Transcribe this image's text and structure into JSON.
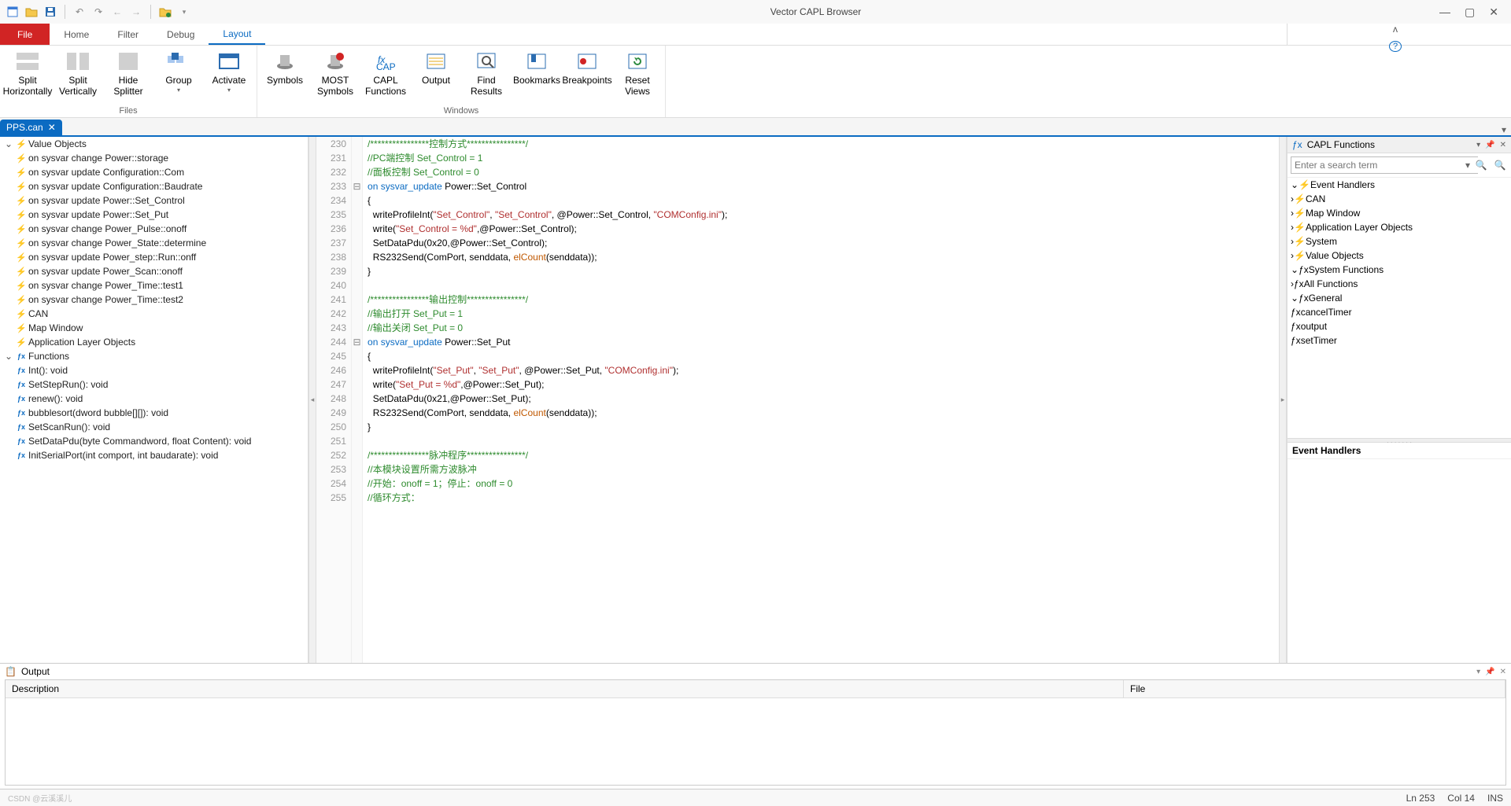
{
  "title": "Vector CAPL Browser",
  "ribbonTabs": {
    "file": "File",
    "home": "Home",
    "filter": "Filter",
    "debug": "Debug",
    "layout": "Layout"
  },
  "ribbon": {
    "files": {
      "label": "Files",
      "splitH": "Split\nHorizontally",
      "splitV": "Split\nVertically",
      "hideSplitter": "Hide\nSplitter",
      "group": "Group",
      "activate": "Activate"
    },
    "windows": {
      "label": "Windows",
      "symbols": "Symbols",
      "most": "MOST\nSymbols",
      "capl": "CAPL\nFunctions",
      "output": "Output",
      "find": "Find\nResults",
      "bookmarks": "Bookmarks",
      "breakpoints": "Breakpoints",
      "reset": "Reset\nViews"
    }
  },
  "fileTab": "PPS.can",
  "leftTree": {
    "valueObjects": "Value Objects",
    "items": [
      "on sysvar change Power::storage",
      "on sysvar update Configuration::Com",
      "on sysvar update Configuration::Baudrate",
      "on sysvar update Power::Set_Control",
      "on sysvar update Power::Set_Put",
      "on sysvar change Power_Pulse::onoff",
      "on sysvar change Power_State::determine",
      "on sysvar update Power_step::Run::onff",
      "on sysvar update Power_Scan::onoff",
      "on sysvar change Power_Time::test1",
      "on sysvar change Power_Time::test2"
    ],
    "can": "CAN",
    "mapwin": "Map Window",
    "alo": "Application Layer Objects",
    "functions": "Functions",
    "funcItems": [
      "Int(): void",
      "SetStepRun(): void",
      "renew(): void",
      "bubblesort(dword bubble[][]): void",
      "SetScanRun(): void",
      "SetDataPdu(byte Commandword, float Content): void",
      "InitSerialPort(int comport, int baudarate): void"
    ]
  },
  "code": {
    "startLine": 230,
    "lines": [
      {
        "fold": "",
        "html": "<span class='c-cmt'>/****************控制方式****************/</span>"
      },
      {
        "fold": "",
        "html": "<span class='c-cmt'>//PC端控制 Set_Control = 1</span>"
      },
      {
        "fold": "",
        "html": "<span class='c-cmt'>//面板控制 Set_Control = 0</span>"
      },
      {
        "fold": "⊟",
        "html": "<span class='c-kw'>on sysvar_update</span> Power::Set_Control"
      },
      {
        "fold": "",
        "html": "{"
      },
      {
        "fold": "",
        "html": "  writeProfileInt(<span class='c-str'>\"Set_Control\"</span>, <span class='c-str'>\"Set_Control\"</span>, @Power::Set_Control, <span class='c-str'>\"COMConfig.ini\"</span>);"
      },
      {
        "fold": "",
        "html": "  write(<span class='c-str'>\"Set_Control = %d\"</span>,@Power::Set_Control);"
      },
      {
        "fold": "",
        "html": "  SetDataPdu(0x20,@Power::Set_Control);"
      },
      {
        "fold": "",
        "html": "  RS232Send(ComPort, senddata, <span class='c-fn'>elCount</span>(senddata));"
      },
      {
        "fold": "",
        "html": "}"
      },
      {
        "fold": "",
        "html": ""
      },
      {
        "fold": "",
        "html": "<span class='c-cmt'>/****************输出控制****************/</span>"
      },
      {
        "fold": "",
        "html": "<span class='c-cmt'>//输出打开 Set_Put = 1</span>"
      },
      {
        "fold": "",
        "html": "<span class='c-cmt'>//输出关闭 Set_Put = 0</span>"
      },
      {
        "fold": "⊟",
        "html": "<span class='c-kw'>on sysvar_update</span> Power::Set_Put"
      },
      {
        "fold": "",
        "html": "{"
      },
      {
        "fold": "",
        "html": "  writeProfileInt(<span class='c-str'>\"Set_Put\"</span>, <span class='c-str'>\"Set_Put\"</span>, @Power::Set_Put, <span class='c-str'>\"COMConfig.ini\"</span>);"
      },
      {
        "fold": "",
        "html": "  write(<span class='c-str'>\"Set_Put = %d\"</span>,@Power::Set_Put);"
      },
      {
        "fold": "",
        "html": "  SetDataPdu(0x21,@Power::Set_Put);"
      },
      {
        "fold": "",
        "html": "  RS232Send(ComPort, senddata, <span class='c-fn'>elCount</span>(senddata));"
      },
      {
        "fold": "",
        "html": "}"
      },
      {
        "fold": "",
        "html": ""
      },
      {
        "fold": "",
        "html": "<span class='c-cmt'>/****************脉冲程序****************/</span>"
      },
      {
        "fold": "",
        "html": "<span class='c-cmt'>//本模块设置所需方波脉冲</span>"
      },
      {
        "fold": "",
        "html": "<span class='c-cmt'>//开始：onoff = 1；停止：onoff = 0</span>"
      },
      {
        "fold": "",
        "html": "<span class='c-cmt'>//循环方式：</span>"
      }
    ]
  },
  "rightPanel": {
    "title": "CAPL Functions",
    "searchPlaceholder": "Enter a search term",
    "eventHandlers": "Event Handlers",
    "eh": [
      "CAN",
      "Map Window",
      "Application Layer Objects",
      "System",
      "Value Objects"
    ],
    "sysFunc": "System Functions",
    "allFunc": "All Functions",
    "general": "General",
    "gen": [
      "cancelTimer",
      "output",
      "setTimer"
    ],
    "detailTitle": "Event Handlers"
  },
  "output": {
    "title": "Output",
    "colDesc": "Description",
    "colFile": "File"
  },
  "status": {
    "ln": "Ln 253",
    "col": "Col 14",
    "ins": "INS"
  },
  "watermark": "CSDN @云溪溪儿"
}
